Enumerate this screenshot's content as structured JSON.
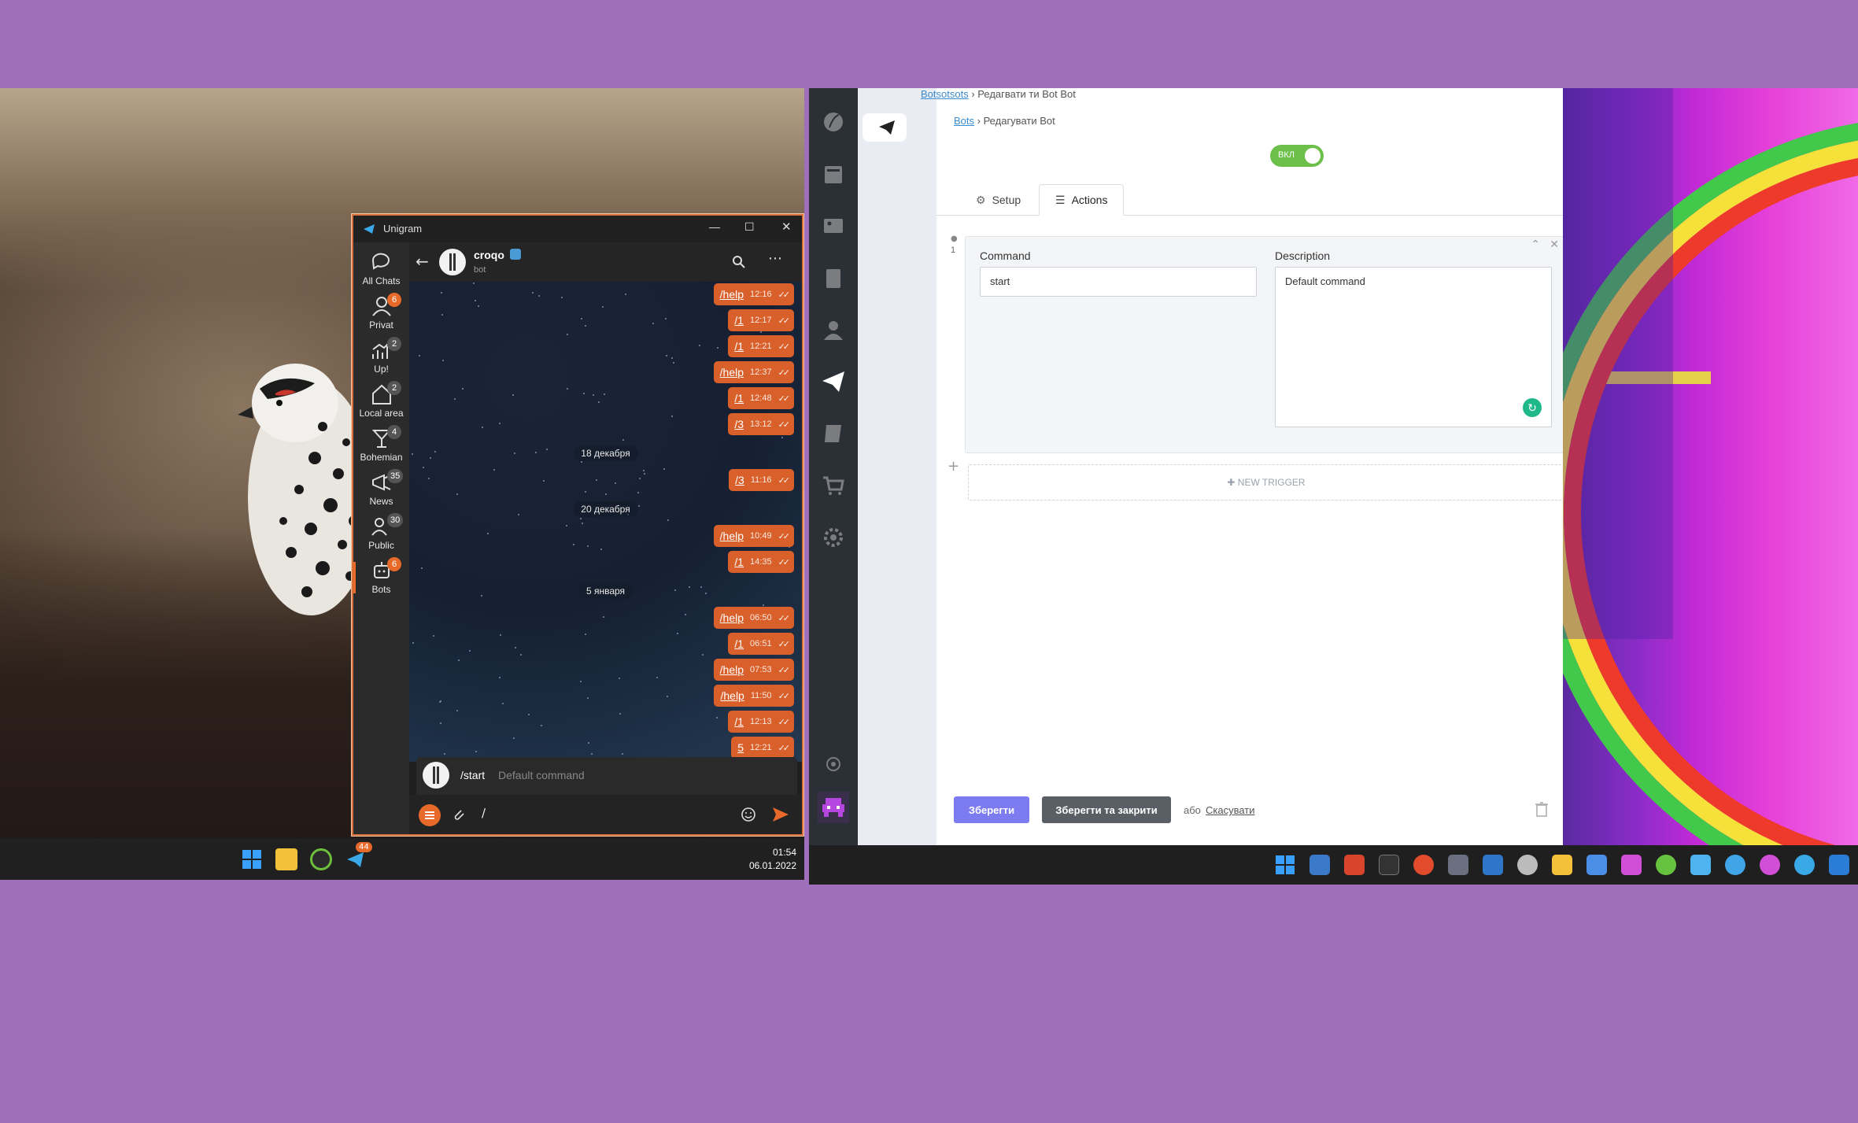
{
  "colors": {
    "accent_orange": "#d9602a",
    "toggle_green": "#6cc04a",
    "save_purple": "#7d7bf0",
    "save_close_gray": "#5a5f66"
  },
  "left_taskbar": {
    "clock_time": "01:54",
    "clock_date": "06.01.2022",
    "telegram_badge": "44"
  },
  "unigram": {
    "app_title": "Unigram",
    "chat_name": "croqo",
    "chat_subtitle": "bot",
    "folders": [
      {
        "label": "All Chats",
        "badge": ""
      },
      {
        "label": "Privat",
        "badge": "6"
      },
      {
        "label": "Up!",
        "badge": "2"
      },
      {
        "label": "Local area",
        "badge": "2"
      },
      {
        "label": "Bohemian",
        "badge": "4"
      },
      {
        "label": "News",
        "badge": "35"
      },
      {
        "label": "Public",
        "badge": "30"
      },
      {
        "label": "Bots",
        "badge": "6"
      }
    ],
    "messages": [
      {
        "text": "/help",
        "time": "12:16"
      },
      {
        "text": "/1",
        "time": "12:17"
      },
      {
        "text": "/1",
        "time": "12:21"
      },
      {
        "text": "/help",
        "time": "12:37"
      },
      {
        "text": "/1",
        "time": "12:48"
      },
      {
        "text": "/3",
        "time": "13:12"
      },
      {
        "date": "18 декабря"
      },
      {
        "text": "/3",
        "time": "11:16"
      },
      {
        "date": "20 декабря"
      },
      {
        "text": "/help",
        "time": "10:49"
      },
      {
        "text": "/1",
        "time": "14:35"
      },
      {
        "date": "5 января"
      },
      {
        "text": "/help",
        "time": "06:50"
      },
      {
        "text": "/1",
        "time": "06:51"
      },
      {
        "text": "/help",
        "time": "07:53"
      },
      {
        "text": "/help",
        "time": "11:50"
      },
      {
        "text": "/1",
        "time": "12:13"
      },
      {
        "text": "5",
        "time": "12:21"
      }
    ],
    "suggestion": {
      "command": "/start",
      "description": "Default command"
    },
    "composer_text": "/"
  },
  "admin": {
    "breadcrumb_top": {
      "link": "Botsotsots",
      "rest": "› Редаг",
      "overlay": "вати ти Bot Bot"
    },
    "breadcrumb": {
      "link": "Bots",
      "rest": "› Редагувати Bot"
    },
    "toggle_label": "ВКЛ",
    "tabs": [
      "Setup",
      "Actions"
    ],
    "action_index": "1",
    "command_label": "Command",
    "command_value": "start",
    "description_label": "Description",
    "description_value": "Default command",
    "new_trigger": "NEW TRIGGER",
    "save": "Зберегти",
    "save_close": "Зберегти та закрити",
    "or": "або",
    "cancel": "Скасувати"
  }
}
